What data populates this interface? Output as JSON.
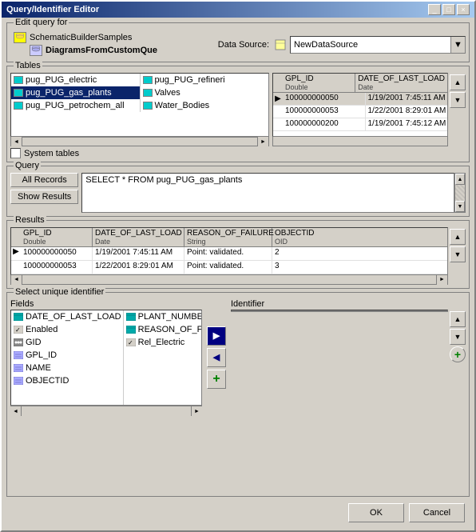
{
  "window": {
    "title": "Query/Identifier Editor",
    "title_buttons": [
      "_",
      "□",
      "×"
    ]
  },
  "edit_query": {
    "label": "Edit query for",
    "tree_item_parent": "SchematicBuilderSamples",
    "tree_item_child": "DiagramsFromCustomQue",
    "datasource_label": "Data Source:",
    "datasource_value": "NewDataSource"
  },
  "tables": {
    "label": "Tables",
    "list": [
      {
        "name": "pug_PUG_electric",
        "icon": "cyan"
      },
      {
        "name": "pug_PUG_gas_plants",
        "icon": "cyan",
        "selected": true
      },
      {
        "name": "pug_PUG_petrochem_all",
        "icon": "cyan"
      },
      {
        "name": "pug_PUG_refineri",
        "icon": "cyan"
      },
      {
        "name": "Valves",
        "icon": "cyan"
      },
      {
        "name": "Water_Bodies",
        "icon": "cyan"
      }
    ],
    "system_tables_label": "System tables",
    "preview_columns": [
      {
        "name": "GPL_ID",
        "type": "Double"
      },
      {
        "name": "DATE_OF_LAST_LOAD",
        "type": "Date"
      }
    ],
    "preview_rows": [
      {
        "arrow": true,
        "col1": "100000000050",
        "col2": "1/19/2001 7:45:11 AM"
      },
      {
        "arrow": false,
        "col1": "100000000053",
        "col2": "1/22/2001 8:29:01 AM"
      },
      {
        "arrow": false,
        "col1": "100000000200",
        "col2": "1/19/2001 7:45:12 AM"
      }
    ]
  },
  "query": {
    "label": "Query",
    "all_records_btn": "All Records",
    "show_results_btn": "Show Results",
    "query_text": "SELECT * FROM pug_PUG_gas_plants"
  },
  "results": {
    "label": "Results",
    "columns": [
      {
        "name": "GPL_ID",
        "type": "Double"
      },
      {
        "name": "DATE_OF_LAST_LOAD",
        "type": "Date"
      },
      {
        "name": "REASON_OF_FAILURE",
        "type": "String"
      },
      {
        "name": "OBJECTID",
        "type": "OID"
      }
    ],
    "rows": [
      {
        "arrow": true,
        "cells": [
          "100000000050",
          "1/19/2001 7:45:11 AM",
          "Point: validated.",
          "2"
        ]
      },
      {
        "arrow": false,
        "cells": [
          "100000000053",
          "1/22/2001 8:29:01 AM",
          "Point: validated.",
          "3"
        ]
      }
    ]
  },
  "select_uid": {
    "label": "Select unique identifier",
    "fields_label": "Fields",
    "identifier_label": "Identifier",
    "fields_col1": [
      {
        "name": "DATE_OF_LAST_LOAD",
        "icon": "date"
      },
      {
        "name": "Enabled",
        "icon": "check"
      },
      {
        "name": "GID",
        "icon": "dots"
      },
      {
        "name": "GPL_ID",
        "icon": "field"
      },
      {
        "name": "NAME",
        "icon": "field"
      },
      {
        "name": "OBJECTID",
        "icon": "field"
      }
    ],
    "fields_col2": [
      {
        "name": "PLANT_NUMBE",
        "icon": "date"
      },
      {
        "name": "REASON_OF_F",
        "icon": "date"
      },
      {
        "name": "Rel_Electric",
        "icon": "check"
      }
    ],
    "transfer_btn_right": "▶",
    "transfer_btn_left": "◀",
    "add_btn": "+"
  },
  "bottom": {
    "ok_label": "OK",
    "cancel_label": "Cancel"
  }
}
